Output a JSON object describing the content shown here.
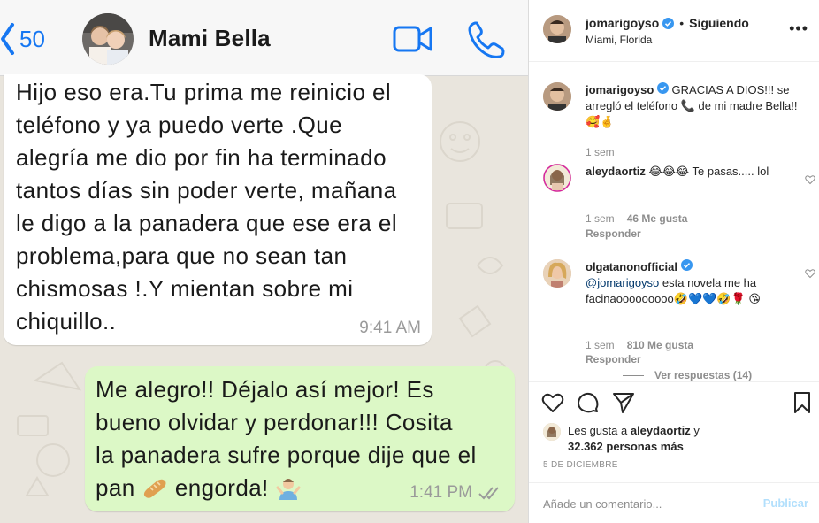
{
  "chat": {
    "back_count": "50",
    "contact_name": "Mami Bella",
    "incoming": {
      "lines": [
        "Hijo eso era.Tu prima me reinicio el",
        "teléfono y ya puedo verte .Que",
        "alegría me dio por fin ha terminado",
        "tantos días sin poder verte, mañana",
        "le digo a la panadera que ese era el",
        "problema,para que no sean tan",
        "chismosas !.Y mientan sobre mi",
        "chiquillo.."
      ],
      "time": "9:41 AM"
    },
    "outgoing": {
      "lines": [
        "Me alegro!! Déjalo así mejor! Es",
        "bueno olvidar y perdonar!!! Cosita",
        "la panadera sufre porque dije que el"
      ],
      "last_line_start": "pan",
      "last_line_end": "engorda!",
      "time": "1:41 PM"
    }
  },
  "instagram": {
    "header": {
      "username": "jomarigoyso",
      "separator": "•",
      "follow_label": "Siguiendo",
      "location": "Miami, Florida",
      "more_label": "•••"
    },
    "caption": {
      "username": "jomarigoyso",
      "text_a": "GRACIAS A DIOS!!! se arregló el teléfono",
      "text_b": "de mi madre Bella!!",
      "time": "1 sem"
    },
    "comments": [
      {
        "username": "aleydaortiz",
        "text_a": "Te pasas..... lol",
        "time": "1 sem",
        "likes": "46 Me gusta",
        "reply": "Responder"
      },
      {
        "username": "olgatanonofficial",
        "mention": "@jomarigoyso",
        "text_a": "esta novela me ha facinaooooooooo",
        "time": "1 sem",
        "likes": "810 Me gusta",
        "reply": "Responder"
      }
    ],
    "view_replies": "Ver respuestas (14)",
    "likes": {
      "prefix": "Les gusta a",
      "user": "aleydaortiz",
      "conj": "y",
      "count": "32.362 personas más"
    },
    "date": "5 DE DICIEMBRE",
    "add_comment": {
      "placeholder": "Añade un comentario...",
      "publish": "Publicar"
    }
  }
}
